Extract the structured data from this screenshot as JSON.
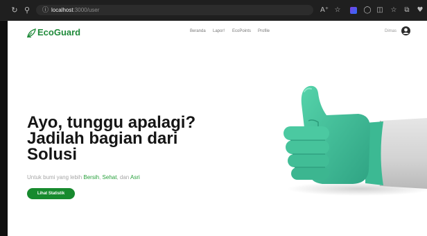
{
  "browser": {
    "url_host": "localhost",
    "url_path": ":3000/user"
  },
  "header": {
    "logo_text": "EcoGuard",
    "nav": [
      "Beranda",
      "Lapor!",
      "EcoPoints",
      "Profile"
    ],
    "user_name": "Dimas"
  },
  "hero": {
    "headline_line1": "Ayo, tunggu apalagi?",
    "headline_line2": "Jadilah bagian dari",
    "headline_line3": "Solusi",
    "sub_prefix": "Untuk bumi yang lebih ",
    "sub_word1": "Bersih",
    "sub_sep1": ", ",
    "sub_word2": "Sehat",
    "sub_sep2": ", dan ",
    "sub_word3": "Asri",
    "cta_label": "Lihat Statistik"
  },
  "colors": {
    "brand": "#1f8a3a",
    "accent_text": "#27a03b",
    "cta_bg": "#178a2e",
    "glove": "#43c39b",
    "sleeve": "#d9d9d9"
  },
  "icons": [
    "back-icon",
    "search-icon",
    "info-icon",
    "read-aloud-icon",
    "favorite-icon",
    "extension-icon",
    "copilot-icon",
    "split-screen-icon",
    "favorites-bar-icon",
    "collections-icon",
    "heart-icon",
    "leaf-icon",
    "user-avatar-icon"
  ]
}
